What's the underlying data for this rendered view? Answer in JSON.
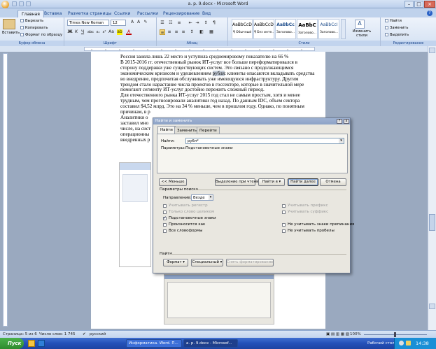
{
  "window": {
    "title": "а. р. 9.docx - Microsoft Word"
  },
  "ribbon_tabs": [
    "Главная",
    "Вставка",
    "Разметка страницы",
    "Ссылки",
    "Рассылки",
    "Рецензирование",
    "Вид"
  ],
  "clipboard": {
    "paste": "Вставить",
    "cut": "Вырезать",
    "copy": "Копировать",
    "format_painter": "Формат по образцу",
    "group": "Буфер обмена"
  },
  "font": {
    "name": "Times New Roman",
    "size": "12",
    "group": "Шрифт",
    "bold": "Ж",
    "italic": "К",
    "underline": "Ч"
  },
  "paragraph": {
    "group": "Абзац"
  },
  "styles": {
    "group": "Стили",
    "items": [
      {
        "preview": "AaBbCcDc",
        "name": "¶ Обычный"
      },
      {
        "preview": "AaBbCcDc",
        "name": "¶ Без инте..."
      },
      {
        "preview": "AaBbCc",
        "name": "Заголово..."
      },
      {
        "preview": "AaBbC",
        "name": "Заголово..."
      },
      {
        "preview": "AaBbCcI",
        "name": "Заголово..."
      }
    ],
    "change_styles": "Изменить стили"
  },
  "editing": {
    "group": "Редактирование",
    "find": "Найти",
    "replace": "Заменить",
    "select": "Выделить"
  },
  "document": {
    "lines": [
      "Россия заняла лишь 22 место и уступила среднемировому показателю на 66 %",
      "В 2015-2016 гг. отечественный рынок ИТ-услуг все больше переформатировался в",
      "сторону поддержки уже существующих систем. Это связано с продолжающимся",
      "экономическим кризисом и удешевлением рубля: клиенты опасаются вкладывать средства",
      "во внедрение, предпочитая обслуживать уже имеющуюся инфраструктуру. Другим",
      "трендом стало нарастание числа проектов в госсекторе, которые в значительной мере",
      "помогают сегменту ИТ-услуг достойно пережить сложный период.",
      "Для отечественного рынка ИТ-услуг 2015 год стал не самым простым, хотя и менее",
      "трудным, чем прогнозировали аналитики год назад. По данным IDC, объем сектора",
      "составил $4,52 млрд. Это на 34 % меньше, чем в прошлом году. Однако, по понятным",
      "причинам, в р",
      "Аналитики о",
      "заставил мно",
      "числе, на сист",
      "операционны",
      "внедренных р"
    ]
  },
  "dialog": {
    "title": "Найти и заменить",
    "close": "x",
    "help": "?",
    "tabs": [
      "Найти",
      "Заменить",
      "Перейти"
    ],
    "find_label": "Найти:",
    "find_value": "рубл*",
    "params_label": "Параметры:",
    "params_value": "Подстановочные знаки",
    "buttons": {
      "less": "<< Меньше",
      "reading_highlight": "Выделение при чтении ▾",
      "find_in": "Найти в ▾",
      "find_next": "Найти далее",
      "cancel": "Отмена"
    },
    "search_options": "Параметры поиска",
    "direction_label": "Направление:",
    "direction_value": "Везде",
    "options_left": [
      {
        "label": "Учитывать регистр",
        "checked": false,
        "enabled": false
      },
      {
        "label": "Только слово целиком",
        "checked": false,
        "enabled": false
      },
      {
        "label": "Подстановочные знаки",
        "checked": true,
        "enabled": true
      },
      {
        "label": "Произносится как",
        "checked": false,
        "enabled": true
      },
      {
        "label": "Все словоформы",
        "checked": false,
        "enabled": true
      }
    ],
    "options_right": [
      {
        "label": "Учитывать префикс",
        "checked": false,
        "enabled": false
      },
      {
        "label": "Учитывать суффикс",
        "checked": false,
        "enabled": false
      },
      {
        "label": "Не учитывать знаки препинания",
        "checked": false,
        "enabled": true
      },
      {
        "label": "Не учитывать пробелы",
        "checked": false,
        "enabled": true
      }
    ],
    "find_section": "Найти",
    "format_btn": "Формат ▾",
    "special_btn": "Специальный ▾",
    "clear_format_btn": "Снять форматирование"
  },
  "status": {
    "page": "Страница: 5 из 6",
    "words": "Число слов: 1 745",
    "lang": "русский",
    "zoom": "100%"
  },
  "taskbar": {
    "start": "Пуск",
    "items": [
      "Информатика. Word. П...",
      "а. р. 9.docx - Microsof..."
    ],
    "desktop": "Рабочий стол",
    "clock": "14:38"
  }
}
